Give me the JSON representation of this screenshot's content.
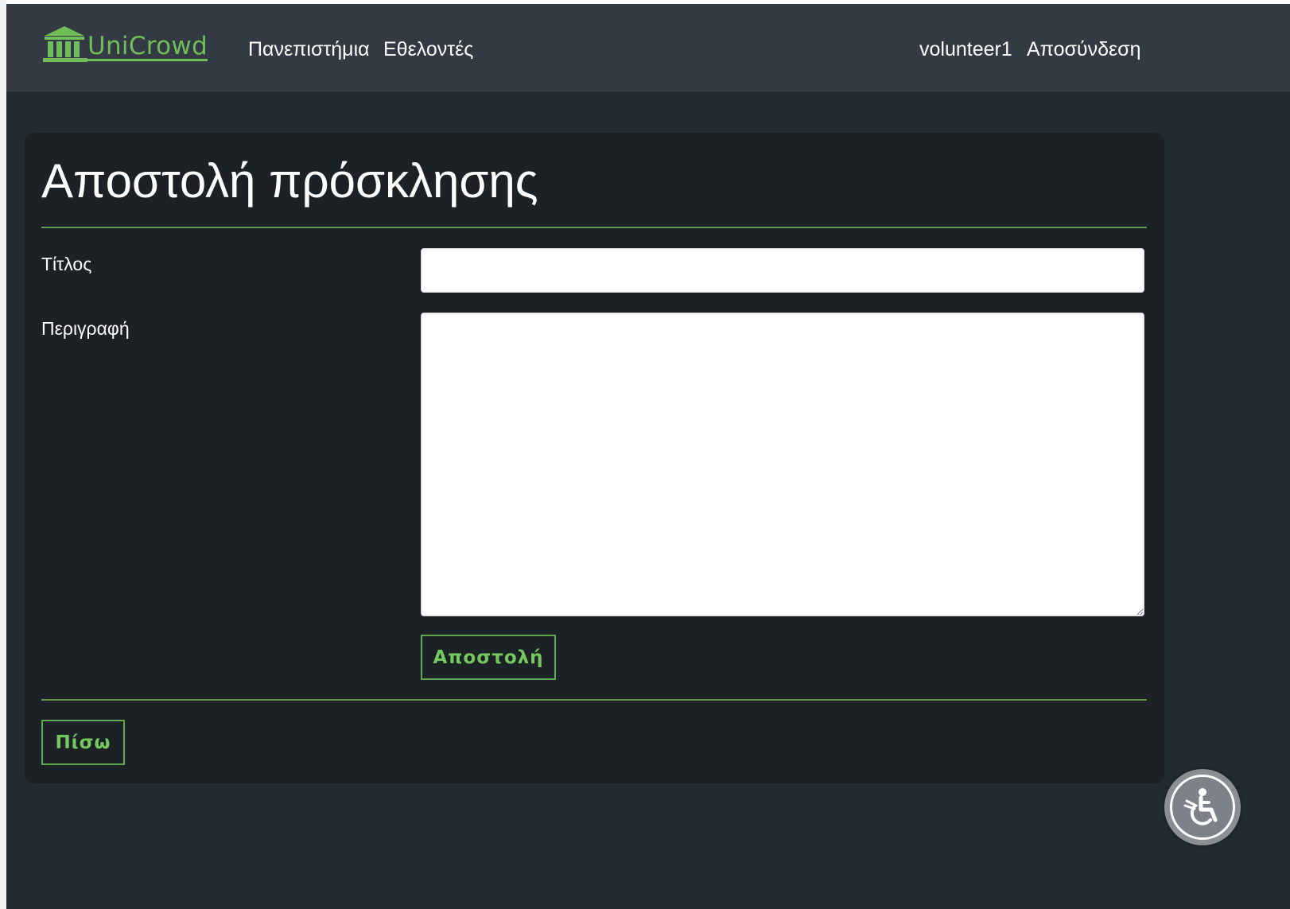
{
  "navbar": {
    "brand": "UniCrowd",
    "links": {
      "universities": "Πανεπιστήμια",
      "volunteers": "Εθελοντές"
    },
    "user": "volunteer1",
    "logout": "Αποσύνδεση"
  },
  "form": {
    "title": "Αποστολή πρόσκλησης",
    "title_label": "Τίτλος",
    "title_value": "",
    "description_label": "Περιγραφή",
    "description_value": "",
    "submit_label": "Αποστολή",
    "back_label": "Πίσω"
  },
  "accessibility": {
    "icon": "accessibility-wheelchair-icon"
  },
  "colors": {
    "accent": "#6fbe5a",
    "navbar_bg": "#343a43",
    "page_bg": "#222b32",
    "card_bg": "#1c2126"
  }
}
